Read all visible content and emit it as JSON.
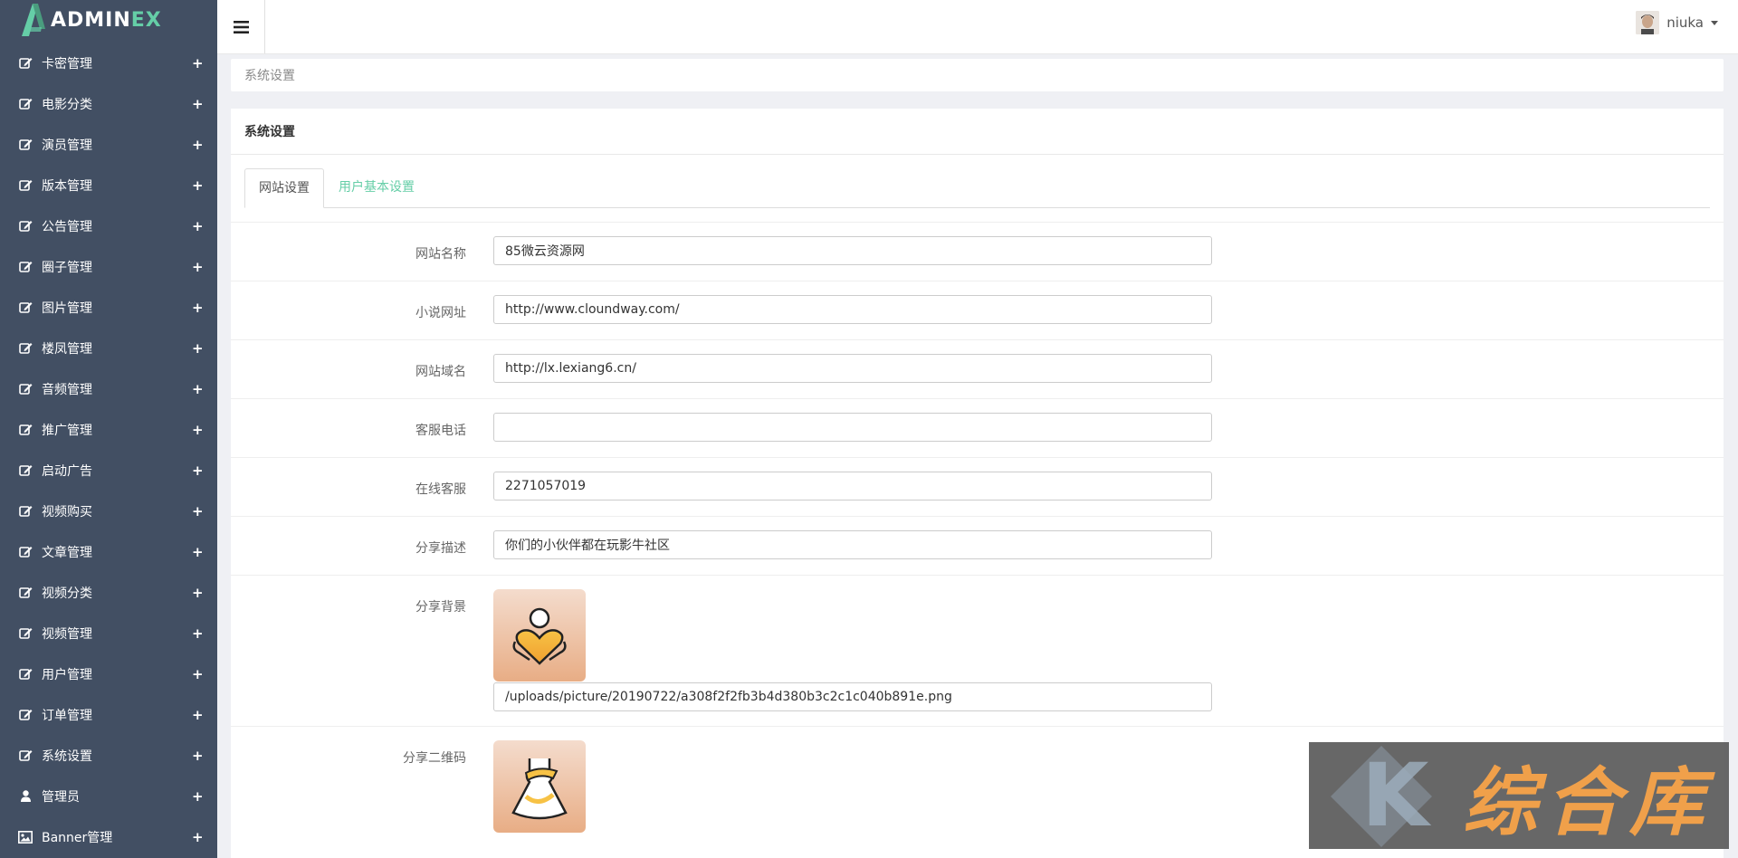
{
  "logo": {
    "text_main": "ADMIN",
    "text_accent": "EX"
  },
  "sidebar": {
    "items": [
      {
        "label": "卡密管理",
        "icon": "edit-icon"
      },
      {
        "label": "电影分类",
        "icon": "edit-icon"
      },
      {
        "label": "演员管理",
        "icon": "edit-icon"
      },
      {
        "label": "版本管理",
        "icon": "edit-icon"
      },
      {
        "label": "公告管理",
        "icon": "edit-icon"
      },
      {
        "label": "圈子管理",
        "icon": "edit-icon"
      },
      {
        "label": "图片管理",
        "icon": "edit-icon"
      },
      {
        "label": "楼凤管理",
        "icon": "edit-icon"
      },
      {
        "label": "音频管理",
        "icon": "edit-icon"
      },
      {
        "label": "推广管理",
        "icon": "edit-icon"
      },
      {
        "label": "启动广告",
        "icon": "edit-icon"
      },
      {
        "label": "视频购买",
        "icon": "edit-icon"
      },
      {
        "label": "文章管理",
        "icon": "edit-icon"
      },
      {
        "label": "视频分类",
        "icon": "edit-icon"
      },
      {
        "label": "视频管理",
        "icon": "edit-icon"
      },
      {
        "label": "用户管理",
        "icon": "edit-icon"
      },
      {
        "label": "订单管理",
        "icon": "edit-icon"
      },
      {
        "label": "系统设置",
        "icon": "edit-icon"
      },
      {
        "label": "管理员",
        "icon": "user-icon"
      },
      {
        "label": "Banner管理",
        "icon": "image-icon"
      }
    ],
    "expand_symbol": "+"
  },
  "header": {
    "username": "niuka"
  },
  "breadcrumb": {
    "text": "系统设置"
  },
  "panel": {
    "title": "系统设置",
    "tabs": [
      {
        "label": "网站设置",
        "active": true
      },
      {
        "label": "用户基本设置",
        "active": false
      }
    ]
  },
  "form": {
    "site_name": {
      "label": "网站名称",
      "value": "85微云资源网"
    },
    "novel_url": {
      "label": "小说网址",
      "value": "http://www.cloundway.com/"
    },
    "site_domain": {
      "label": "网站域名",
      "value": "http://lx.lexiang6.cn/"
    },
    "service_phone": {
      "label": "客服电话",
      "value": ""
    },
    "online_service": {
      "label": "在线客服",
      "value": "2271057019"
    },
    "share_desc": {
      "label": "分享描述",
      "value": "你们的小伙伴都在玩影牛社区"
    },
    "share_bg": {
      "label": "分享背景",
      "value": "/uploads/picture/20190722/a308f2f2fb3b4d380b3c2c1c040b891e.png"
    },
    "share_qr": {
      "label": "分享二维码"
    }
  },
  "watermark": {
    "text": "综合库"
  },
  "colors": {
    "sidebar_bg": "#424f63",
    "accent": "#65cea7",
    "page_bg": "#eff0f4"
  }
}
